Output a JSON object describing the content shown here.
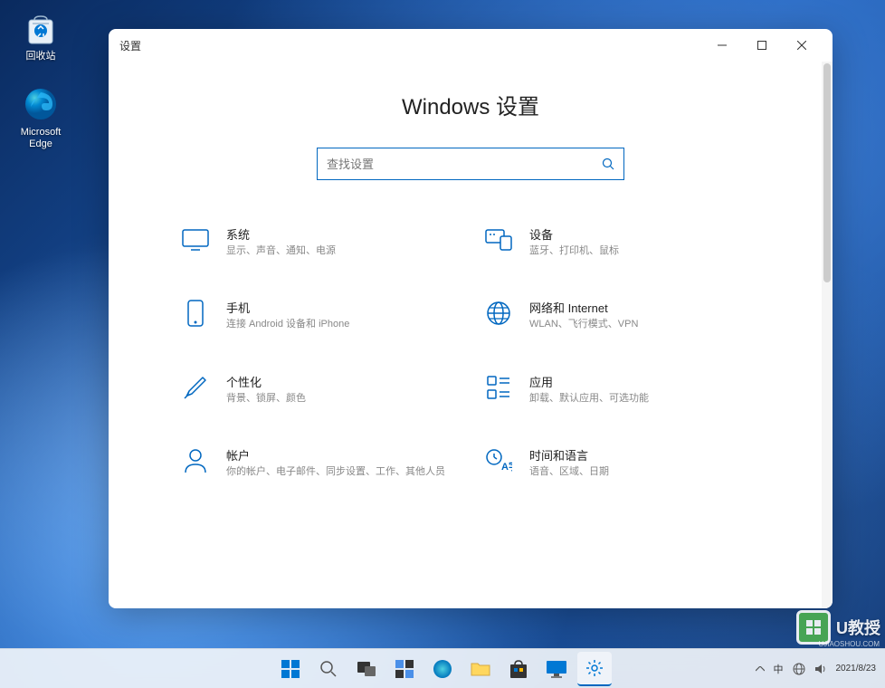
{
  "desktop": {
    "icons": [
      {
        "name": "recycle-bin",
        "label": "回收站"
      },
      {
        "name": "edge",
        "label": "Microsoft Edge"
      }
    ]
  },
  "window": {
    "title": "设置",
    "page_title": "Windows 设置",
    "search_placeholder": "查找设置"
  },
  "categories": [
    {
      "icon": "display",
      "title": "系统",
      "desc": "显示、声音、通知、电源"
    },
    {
      "icon": "devices",
      "title": "设备",
      "desc": "蓝牙、打印机、鼠标"
    },
    {
      "icon": "phone",
      "title": "手机",
      "desc": "连接 Android 设备和 iPhone"
    },
    {
      "icon": "globe",
      "title": "网络和 Internet",
      "desc": "WLAN、飞行模式、VPN"
    },
    {
      "icon": "paint",
      "title": "个性化",
      "desc": "背景、锁屏、颜色"
    },
    {
      "icon": "apps",
      "title": "应用",
      "desc": "卸载、默认应用、可选功能"
    },
    {
      "icon": "person",
      "title": "帐户",
      "desc": "你的帐户、电子邮件、同步设置、工作、其他人员"
    },
    {
      "icon": "time",
      "title": "时间和语言",
      "desc": "语音、区域、日期"
    }
  ],
  "taskbar": {
    "date": "2021/8/23"
  },
  "watermark": {
    "text": "U教授",
    "sub": "UJIAOSHOU.COM"
  },
  "colors": {
    "accent": "#0067c0"
  }
}
